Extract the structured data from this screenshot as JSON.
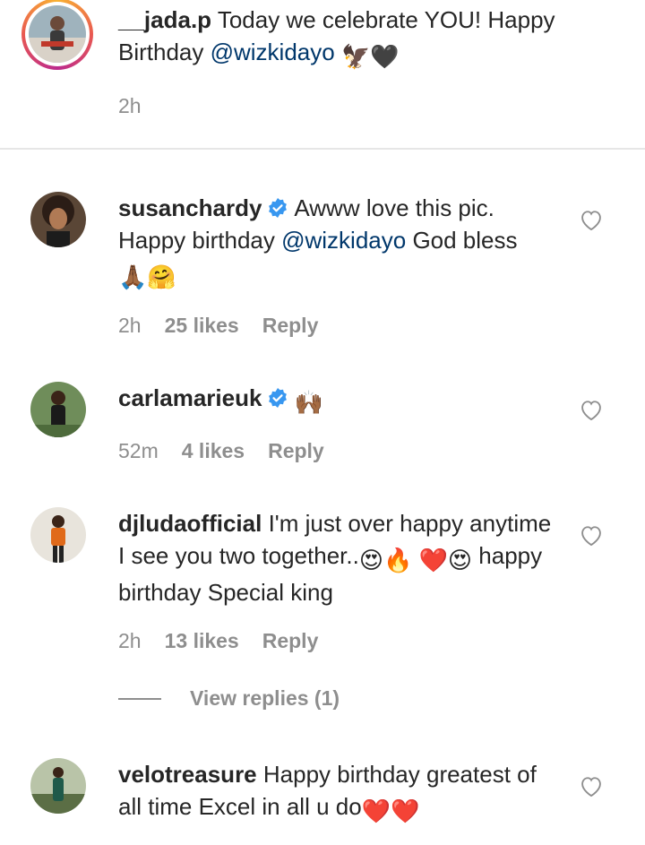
{
  "caption": {
    "username": "__jada.p",
    "text": " Today we celebrate YOU! Happy Birthday ",
    "mention": "@wizkidayo",
    "emoji": "🦅🖤",
    "time": "2h"
  },
  "comments": [
    {
      "username": "susanchardy",
      "verified": true,
      "text_before": "Awww love this pic. Happy birthday ",
      "mention": "@wizkidayo",
      "text_after": " God bless ",
      "emoji": "🙏🏾🤗",
      "time": "2h",
      "likes": "25 likes",
      "reply": "Reply"
    },
    {
      "username": "carlamarieuk",
      "verified": true,
      "text_before": "",
      "emoji": "🙌🏾",
      "time": "52m",
      "likes": "4 likes",
      "reply": "Reply"
    },
    {
      "username": "djludaofficial",
      "verified": false,
      "text_before": " I'm just over happy anytime I see you two together..",
      "emoji_a": "😍🔥",
      "emoji_b": "❤️😍",
      "text_after": " happy birthday Special king",
      "time": "2h",
      "likes": "13 likes",
      "reply": "Reply",
      "view_replies": "View replies (1)"
    },
    {
      "username": "velotreasure",
      "verified": false,
      "text_before": " Happy birthday greatest of all time Excel in all u do",
      "emoji": "❤️❤️"
    }
  ],
  "icons": {
    "heart": "heart-outline-icon",
    "verified": "verified-badge-icon"
  },
  "colors": {
    "mention": "#00376b",
    "verified": "#3897f0",
    "meta": "#8e8e8e"
  }
}
